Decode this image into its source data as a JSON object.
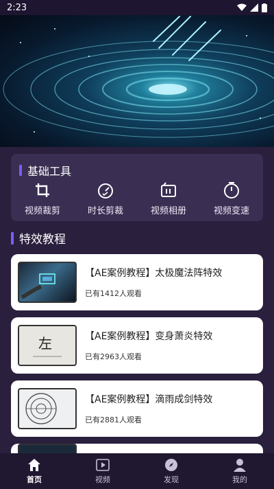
{
  "status_bar": {
    "time": "2:23"
  },
  "tools": {
    "title": "基础工具",
    "items": [
      {
        "label": "视频裁剪",
        "icon": "crop-icon"
      },
      {
        "label": "时长剪裁",
        "icon": "timer-icon"
      },
      {
        "label": "视频相册",
        "icon": "album-icon"
      },
      {
        "label": "视频变速",
        "icon": "speed-icon"
      }
    ]
  },
  "effects": {
    "title": "特效教程",
    "items": [
      {
        "title": "【AE案例教程】太极魔法阵特效",
        "views": "已有1412人观看"
      },
      {
        "title": "【AE案例教程】变身萧炎特效",
        "views": "已有2963人观看"
      },
      {
        "title": "【AE案例教程】滴雨成剑特效",
        "views": "已有2881人观看"
      }
    ]
  },
  "tabbar": {
    "items": [
      {
        "label": "首页",
        "icon": "home-icon",
        "active": true
      },
      {
        "label": "视频",
        "icon": "video-icon",
        "active": false
      },
      {
        "label": "发现",
        "icon": "compass-icon",
        "active": false
      },
      {
        "label": "我的",
        "icon": "user-icon",
        "active": false
      }
    ]
  },
  "colors": {
    "accent": "#7b5cff",
    "background": "#2a1f3d",
    "card": "#3a2e52"
  }
}
